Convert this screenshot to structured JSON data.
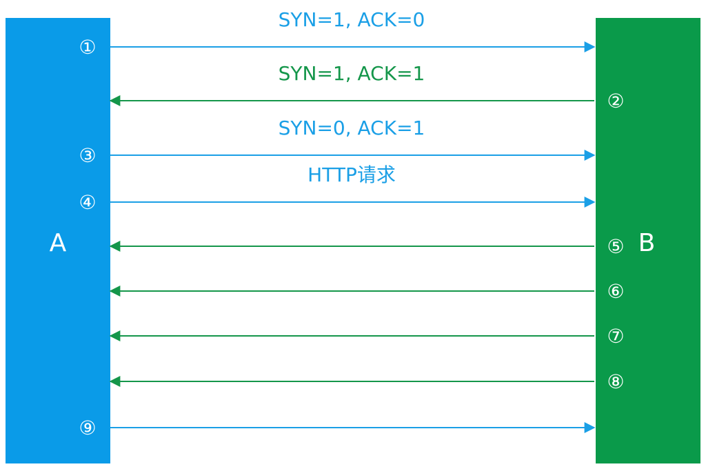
{
  "colors": {
    "host_a": "#0a9be8",
    "host_b": "#0a9a4a",
    "request_arrow": "#1a9fe6",
    "response_arrow": "#14964a"
  },
  "hosts": {
    "a": {
      "label": "A"
    },
    "b": {
      "label": "B"
    }
  },
  "steps": [
    {
      "marker": "①",
      "direction": "A→B",
      "label": "SYN=1, ACK=0"
    },
    {
      "marker": "②",
      "direction": "B→A",
      "label": "SYN=1, ACK=1"
    },
    {
      "marker": "③",
      "direction": "A→B",
      "label": "SYN=0, ACK=1"
    },
    {
      "marker": "④",
      "direction": "A→B",
      "label": "HTTP请求"
    },
    {
      "marker": "⑤",
      "direction": "B→A",
      "label": ""
    },
    {
      "marker": "⑥",
      "direction": "B→A",
      "label": ""
    },
    {
      "marker": "⑦",
      "direction": "B→A",
      "label": ""
    },
    {
      "marker": "⑧",
      "direction": "B→A",
      "label": ""
    },
    {
      "marker": "⑨",
      "direction": "A→B",
      "label": ""
    }
  ]
}
